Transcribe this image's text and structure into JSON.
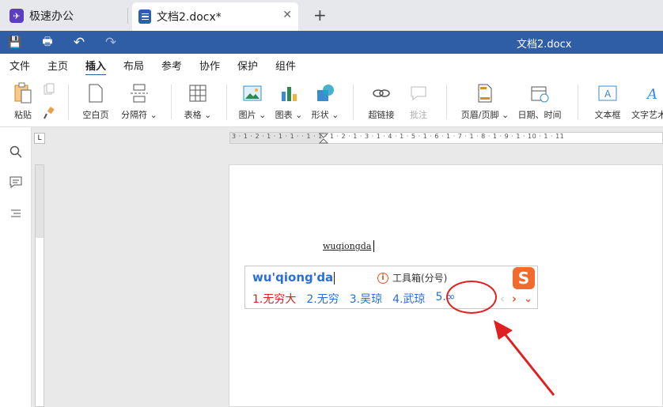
{
  "tabs": {
    "app_label": "极速办公",
    "doc_label": "文档2.docx*",
    "close": "✕",
    "new_tab": "+",
    "app_glyph": "✈"
  },
  "quickbar": {
    "title": "文档2.docx",
    "save": "💾",
    "print": "🖶",
    "undo": "↶",
    "redo": "↷"
  },
  "menu": [
    "文件",
    "主页",
    "插入",
    "布局",
    "参考",
    "协作",
    "保护",
    "组件"
  ],
  "menu_active": "插入",
  "ribbon": {
    "paste": "粘贴",
    "blank_page": "空白页",
    "separator": "分隔符",
    "table": "表格",
    "image": "图片",
    "chart": "图表",
    "shape": "形状",
    "hyperlink": "超链接",
    "comment": "批注",
    "header_footer": "页眉/页脚",
    "datetime": "日期、时间",
    "textbox": "文本框",
    "textart": "文字艺术"
  },
  "ruler": {
    "corner": "L",
    "h_marks": "3 · 1 · 2 · 1 · 1 · 1 ·   · 1 · 1 · 1 · 2 · 1 · 3 · 1 · 4 · 1 · 5 · 1 · 6 · 1 · 7 · 1 · 8 · 1 · 9 · 1 · 10 · 1 · 11"
  },
  "document": {
    "typed_text": "wuqiongda"
  },
  "ime": {
    "input": "wu'qiong'da",
    "toolbox": "工具箱(分号)",
    "info_glyph": "i",
    "logo": "S",
    "candidates": [
      "1.无穷大",
      "2.无穷",
      "3.吴琼",
      "4.武琼",
      "5.∞"
    ],
    "prev": "‹",
    "next": "›",
    "expand": "⌄"
  },
  "colors": {
    "accent": "#2f5ea7",
    "ime_blue": "#2a6fd6",
    "selected": "#d42020",
    "annotation": "#e02020"
  }
}
